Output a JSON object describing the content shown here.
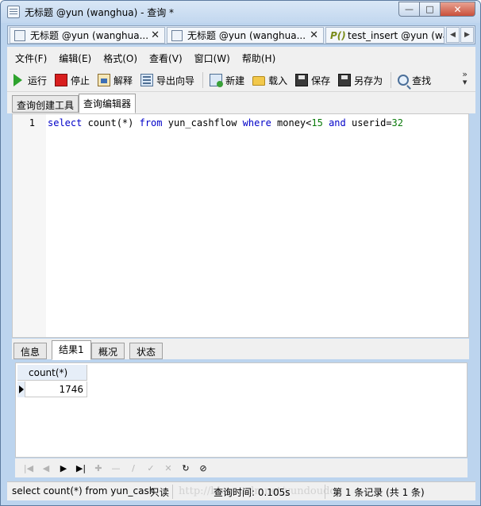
{
  "window": {
    "title": "无标题 @yun (wanghua) - 查询 *",
    "controls": {
      "minimize": "—",
      "maximize": "□",
      "close": "✕"
    }
  },
  "doc_tabs": [
    {
      "label": "无标题 @yun (wanghua...",
      "close": "✕",
      "icon": "query-icon"
    },
    {
      "label": "无标题 @yun (wanghua...",
      "close": "✕",
      "icon": "query-icon"
    },
    {
      "label": "test_insert @yun (wan",
      "icon_text": "P()",
      "icon": "procedure-icon"
    }
  ],
  "menu": [
    "文件(F)",
    "编辑(E)",
    "格式(O)",
    "查看(V)",
    "窗口(W)",
    "帮助(H)"
  ],
  "toolbar": {
    "run": "运行",
    "stop": "停止",
    "explain": "解释",
    "export_wizard": "导出向导",
    "new": "新建",
    "load": "载入",
    "save": "保存",
    "save_as": "另存为",
    "find": "查找"
  },
  "sub_tabs": [
    "查询创建工具",
    "查询编辑器"
  ],
  "editor": {
    "line_number": "1",
    "tokens": [
      {
        "text": "select",
        "kind": "kw"
      },
      {
        "text": " count(*) ",
        "kind": "plain"
      },
      {
        "text": "from",
        "kind": "kw"
      },
      {
        "text": " yun_cashflow ",
        "kind": "plain"
      },
      {
        "text": "where",
        "kind": "kw"
      },
      {
        "text": " money<",
        "kind": "plain"
      },
      {
        "text": "15",
        "kind": "num"
      },
      {
        "text": " ",
        "kind": "plain"
      },
      {
        "text": "and",
        "kind": "kw"
      },
      {
        "text": " userid=",
        "kind": "plain"
      },
      {
        "text": "32",
        "kind": "num"
      }
    ]
  },
  "result_tabs": [
    "信息",
    "结果1",
    "概况",
    "状态"
  ],
  "result_grid": {
    "columns": [
      "count(*)"
    ],
    "rows": [
      [
        "1746"
      ]
    ]
  },
  "statusbar": {
    "sql": "select count(*) from yun_cash",
    "readonly": "只读",
    "query_time": "查询时间: 0.105s",
    "record_info": "第 1 条记录 (共 1 条)",
    "watermark": "http://blog.csdn.net/yundoudou"
  }
}
